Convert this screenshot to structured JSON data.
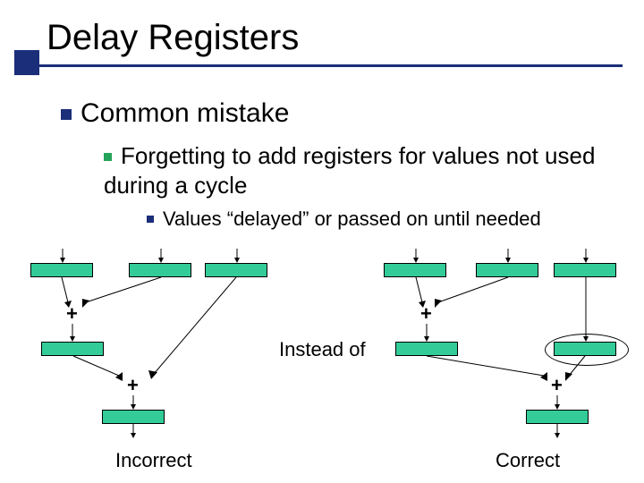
{
  "title": "Delay Registers",
  "bullets": {
    "l1": "Common mistake",
    "l2": "Forgetting to add registers for values not used during a cycle",
    "l3": "Values “delayed” or passed on until needed"
  },
  "diagram": {
    "between": "Instead of",
    "leftLabel": "Incorrect",
    "rightLabel": "Correct",
    "plus": "+"
  }
}
